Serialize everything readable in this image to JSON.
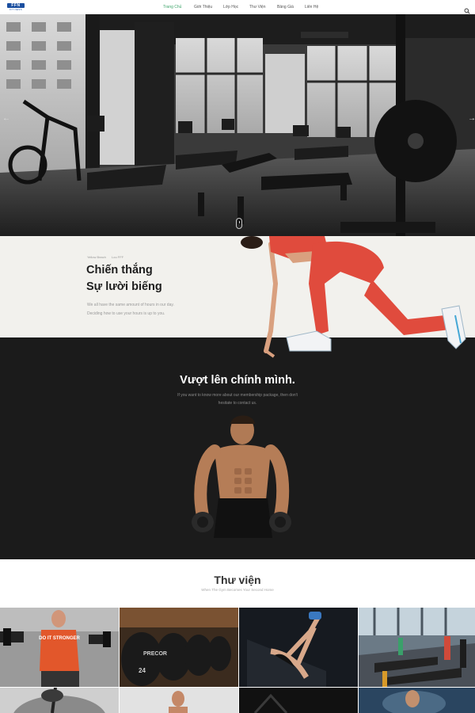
{
  "header": {
    "logo_text": "FFN",
    "logo_sub": "FIT NESS",
    "nav": [
      {
        "label": "Trang Chủ",
        "active": true
      },
      {
        "label": "Giới Thiệu",
        "active": false
      },
      {
        "label": "Lớp Học",
        "active": false
      },
      {
        "label": "Thư Viện",
        "active": false
      },
      {
        "label": "Bảng Giá",
        "active": false
      },
      {
        "label": "Liên Hệ",
        "active": false
      }
    ],
    "search_icon": "search-icon",
    "active_color": "#3fa66b"
  },
  "hero": {
    "prev_arrow": "←",
    "next_arrow": "→",
    "image": "gym-interior-grayscale"
  },
  "slogan": {
    "breadcrumb": [
      "Yellow Beach",
      "Lou FFF"
    ],
    "title_line1": "Chiến thắng",
    "title_line2": "Sự lười biếng",
    "desc_line1": "We all have the same amount of hours in our day.",
    "desc_line2": "Deciding how to use your hours is up to you."
  },
  "promo": {
    "title": "Vượt lên chính mình.",
    "sub_line1": "If you want to know more about our membership package, then don't",
    "sub_line2": "hesitate to contact us."
  },
  "gallery": {
    "title": "Thư viện",
    "subtitle": "When The Gym Becomes Your Second Home",
    "tile_texts": {
      "shirt": "DO IT\nSTRONGER",
      "plate": "PRECOR",
      "plate_weight": "24"
    }
  },
  "colors": {
    "dark_bg": "#1b1b1b",
    "slogan_bg": "#f2f1ed",
    "accent_green": "#3fa66b",
    "brand_blue": "#1b4fa0"
  }
}
